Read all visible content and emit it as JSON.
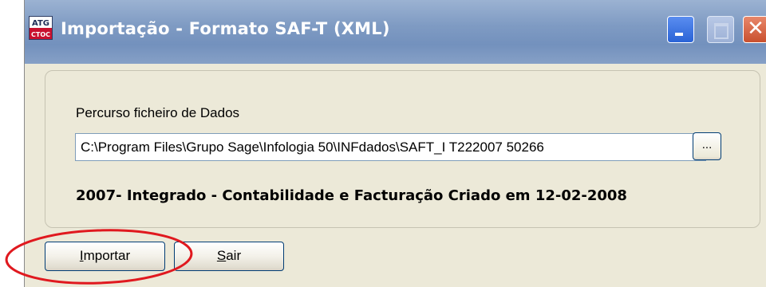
{
  "window": {
    "title": "Importação - Formato SAF-T (XML)",
    "app_icon_text_top": "ATG",
    "app_icon_text_bottom": "CTOC",
    "controls": {
      "minimize_icon": "minimize-icon",
      "maximize_icon": "maximize-icon",
      "close_glyph": "✕"
    }
  },
  "form": {
    "path_label": "Percurso ficheiro de Dados",
    "path_value": "C:\\Program Files\\Grupo Sage\\Infologia 50\\INFdados\\SAFT_I T222007 50266",
    "browse_label": "...",
    "info_text": "2007- Integrado - Contabilidade e Facturação Criado em 12-02-2008"
  },
  "actions": {
    "import_first": "I",
    "import_rest": "mportar",
    "exit_first": "S",
    "exit_rest": "air"
  },
  "colors": {
    "titlebar": "#7f9bc3",
    "window_bg": "#ece9d8",
    "close_button": "#c9502e",
    "highlight_oval": "#e0191f"
  }
}
